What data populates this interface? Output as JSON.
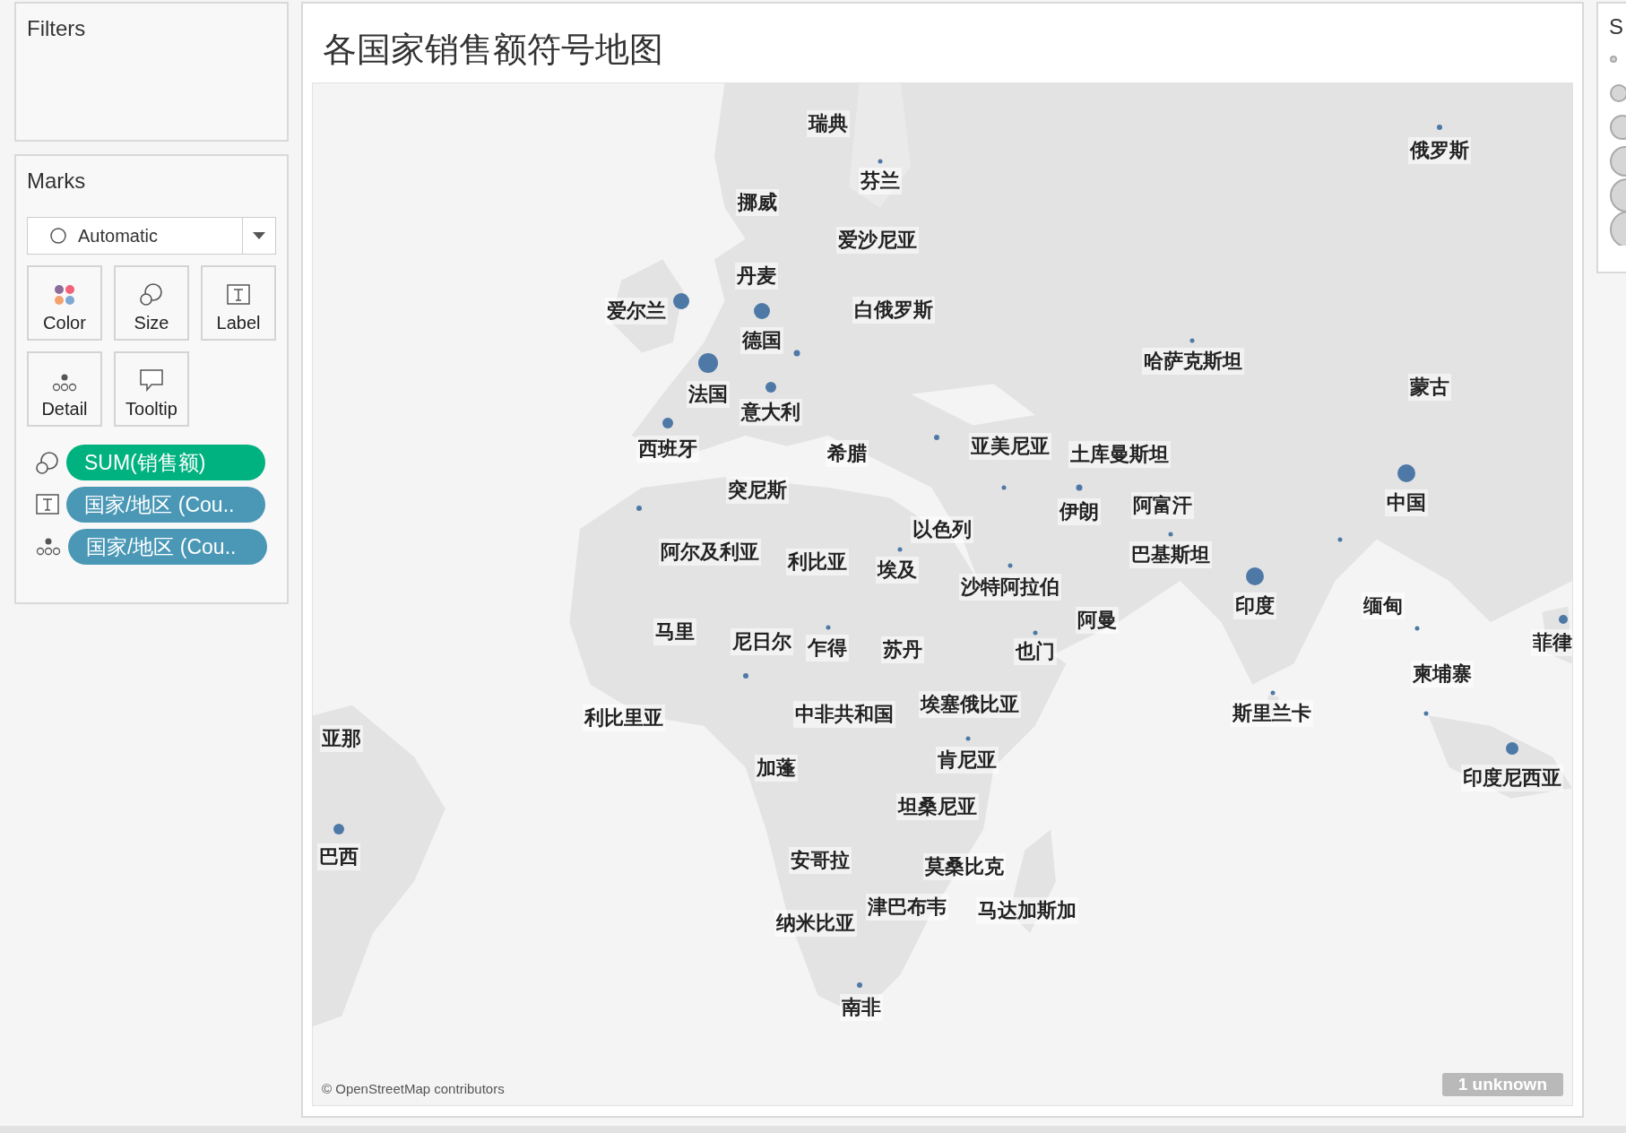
{
  "filters": {
    "title": "Filters"
  },
  "marks": {
    "title": "Marks",
    "mark_type": "Automatic",
    "cards": [
      {
        "label": "Color",
        "kind": "color"
      },
      {
        "label": "Size",
        "kind": "size"
      },
      {
        "label": "Label",
        "kind": "label"
      },
      {
        "label": "Detail",
        "kind": "detail"
      },
      {
        "label": "Tooltip",
        "kind": "tooltip"
      }
    ],
    "shelf": [
      {
        "kind": "size",
        "field": "SUM(销售额)",
        "color": "#00b27f"
      },
      {
        "kind": "label",
        "field": "国家/地区 (Cou..",
        "color": "#4a98b6"
      },
      {
        "kind": "detail",
        "field": "国家/地区 (Cou..",
        "color": "#4a98b6"
      }
    ]
  },
  "sheet": {
    "title": "各国家销售额符号地图",
    "labels": [
      "瑞典",
      "芬兰",
      "挪威",
      "爱沙尼亚",
      "丹麦",
      "爱尔兰",
      "白俄罗斯",
      "德国",
      "法国",
      "意大利",
      "西班牙",
      "希腊",
      "亚美尼亚",
      "土库曼斯坦",
      "哈萨克斯坦",
      "俄罗斯",
      "蒙古",
      "中国",
      "突尼斯",
      "以色列",
      "伊朗",
      "阿富汗",
      "阿尔及利亚",
      "利比亚",
      "埃及",
      "沙特阿拉伯",
      "巴基斯坦",
      "印度",
      "缅甸",
      "菲律",
      "马里",
      "尼日尔",
      "乍得",
      "苏丹",
      "也门",
      "阿曼",
      "柬埔寨",
      "利比里亚",
      "中非共和国",
      "埃塞俄比亚",
      "斯里兰卡",
      "亚那",
      "加蓬",
      "肯尼亚",
      "坦桑尼亚",
      "印度尼西亚",
      "巴西",
      "安哥拉",
      "莫桑比克",
      "津巴布韦",
      "马达加斯加",
      "纳米比亚",
      "南非"
    ],
    "attribution": "© OpenStreetMap contributors",
    "unknown_badge": "1 unknown"
  },
  "legend": {
    "title": "S"
  }
}
